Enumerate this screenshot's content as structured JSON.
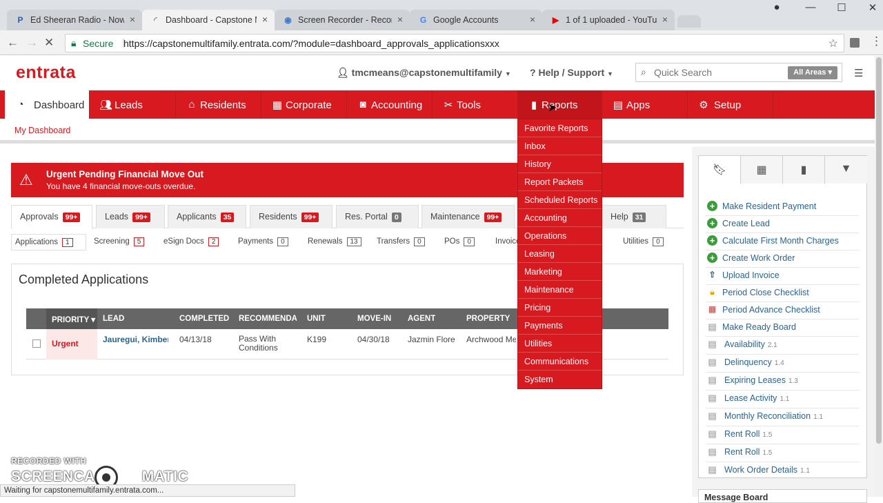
{
  "browser": {
    "tabs": [
      {
        "icon": "pandora-icon",
        "title": "Ed Sheeran Radio - Now"
      },
      {
        "icon": "loading-icon",
        "title": "Dashboard - Capstone M"
      },
      {
        "icon": "screencast-icon",
        "title": "Screen Recorder - Recor"
      },
      {
        "icon": "google-icon",
        "title": "Google Accounts"
      },
      {
        "icon": "youtube-icon",
        "title": "1 of 1 uploaded - YouTu"
      }
    ],
    "secure_label": "Secure",
    "url": "https://capstonemultifamily.entrata.com/?module=dashboard_approvals_applicationsxxx",
    "status_text": "Waiting for capstonemultifamily.entrata.com..."
  },
  "header": {
    "logo": "entrata",
    "user": "tmcmeans@capstonemultifamily",
    "help": "Help / Support",
    "search_placeholder": "Quick Search",
    "search_scope": "All Areas"
  },
  "nav": {
    "items": [
      {
        "label": "Dashboard",
        "icon": "dashboard-icon"
      },
      {
        "label": "Leads",
        "icon": "users-icon"
      },
      {
        "label": "Residents",
        "icon": "home-icon"
      },
      {
        "label": "Corporate",
        "icon": "building-icon"
      },
      {
        "label": "Accounting",
        "icon": "money-icon"
      },
      {
        "label": "Tools",
        "icon": "tools-icon"
      },
      {
        "label": "Reports",
        "icon": "bar-chart-icon"
      },
      {
        "label": "Apps",
        "icon": "store-icon"
      },
      {
        "label": "Setup",
        "icon": "gear-icon"
      }
    ],
    "sub_link": "My Dashboard"
  },
  "reports_menu": [
    "Favorite Reports",
    "Inbox",
    "History",
    "Report Packets",
    "Scheduled Reports",
    "Accounting",
    "Operations",
    "Leasing",
    "Marketing",
    "Maintenance",
    "Pricing",
    "Payments",
    "Utilities",
    "Communications",
    "System"
  ],
  "alert": {
    "title": "Urgent Pending Financial Move Out",
    "message": "You have 4 financial move-outs overdue."
  },
  "main_tabs": [
    {
      "label": "Approvals",
      "count": "99+"
    },
    {
      "label": "Leads",
      "count": "99+"
    },
    {
      "label": "Applicants",
      "count": "35"
    },
    {
      "label": "Residents",
      "count": "99+"
    },
    {
      "label": "Res. Portal",
      "count": "0"
    },
    {
      "label": "Maintenance",
      "count": "99+"
    },
    {
      "label": "Help",
      "count": "31"
    }
  ],
  "sub_tabs": [
    {
      "label": "Applications",
      "count": "1"
    },
    {
      "label": "Screening",
      "count": "5"
    },
    {
      "label": "eSign Docs",
      "count": "2"
    },
    {
      "label": "Payments",
      "count": "0"
    },
    {
      "label": "Renewals",
      "count": "13"
    },
    {
      "label": "Transfers",
      "count": "0"
    },
    {
      "label": "POs",
      "count": "0"
    },
    {
      "label": "Invoice",
      "count": ""
    },
    {
      "label": "Utilities",
      "count": "0"
    }
  ],
  "panel": {
    "title": "Completed Applications",
    "columns": [
      "PRIORITY",
      "LEAD",
      "COMPLETED",
      "RECOMMENDAT",
      "UNIT",
      "MOVE-IN",
      "AGENT",
      "PROPERTY"
    ],
    "rows": [
      {
        "priority": "Urgent",
        "lead": "Jauregui, Kimber",
        "completed": "04/13/18",
        "recommendation_1": "Pass With",
        "recommendation_2": "Conditions",
        "unit": "K199",
        "move_in": "04/30/18",
        "agent": "Jazmin Flore",
        "property": "Archwood Me"
      }
    ]
  },
  "sidebar": {
    "tab_icons": [
      "bookmark-icon",
      "calendar-icon",
      "bar-chart-icon",
      "filter-icon"
    ],
    "items": [
      {
        "label": "Make Resident Payment",
        "icon": "plus-icon",
        "version": ""
      },
      {
        "label": "Create Lead",
        "icon": "plus-icon",
        "version": ""
      },
      {
        "label": "Calculate First Month Charges",
        "icon": "plus-icon",
        "version": ""
      },
      {
        "label": "Create Work Order",
        "icon": "plus-icon",
        "version": ""
      },
      {
        "label": "Upload Invoice",
        "icon": "upload-icon",
        "version": ""
      },
      {
        "label": "Period Close Checklist",
        "icon": "lock-icon",
        "version": ""
      },
      {
        "label": "Period Advance Checklist",
        "icon": "calendar-icon",
        "version": ""
      },
      {
        "label": "Make Ready Board",
        "icon": "report-icon",
        "version": ""
      },
      {
        "label": "Availability",
        "icon": "report-icon",
        "version": "2.1"
      },
      {
        "label": "Delinquency",
        "icon": "report-icon",
        "version": "1.4"
      },
      {
        "label": "Expiring Leases",
        "icon": "report-icon",
        "version": "1.3"
      },
      {
        "label": "Lease Activity",
        "icon": "report-icon",
        "version": "1.1"
      },
      {
        "label": "Monthly Reconciliation",
        "icon": "report-icon",
        "version": "1.1"
      },
      {
        "label": "Rent Roll",
        "icon": "report-icon",
        "version": "1.5"
      },
      {
        "label": "Rent Roll",
        "icon": "report-icon",
        "version": "1.5"
      },
      {
        "label": "Work Order Details",
        "icon": "report-icon",
        "version": "1.1"
      }
    ],
    "message_board": "Message Board"
  },
  "watermark": {
    "line1": "RECORDED WITH",
    "line2a": "SCREENCAST",
    "line2b": "MATIC"
  }
}
